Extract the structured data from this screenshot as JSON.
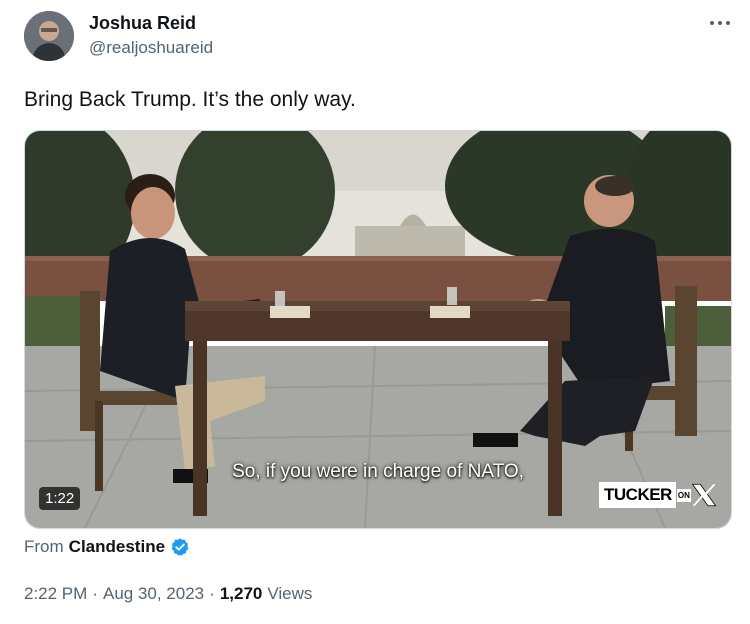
{
  "author": {
    "name": "Joshua Reid",
    "handle": "@realjoshuareid"
  },
  "tweet": {
    "text": "Bring Back Trump. It’s the only way."
  },
  "media": {
    "caption": "So, if you were in charge of NATO,",
    "duration": "1:22",
    "logo_word": "TUCKER",
    "logo_on": "ON",
    "logo_x": "X"
  },
  "source": {
    "prefix": "From",
    "name": "Clandestine"
  },
  "meta": {
    "time": "2:22 PM",
    "date": "Aug 30, 2023",
    "separator": "·",
    "views_count": "1,270",
    "views_label": "Views"
  },
  "icons": {
    "more": "more-horizontal-icon",
    "verified": "verified-badge-icon"
  },
  "colors": {
    "primary_text": "#0f1419",
    "secondary_text": "#536471",
    "verified_blue": "#1d9bf0"
  }
}
